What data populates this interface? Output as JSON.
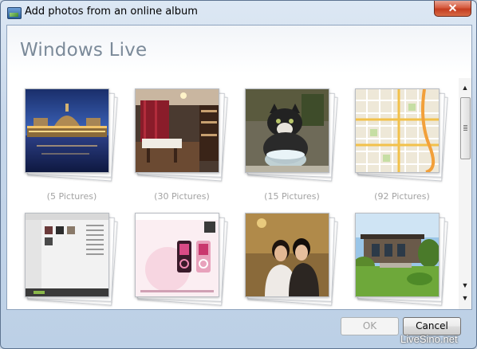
{
  "window": {
    "title": "Add photos from an online album",
    "close_glyph": "✕"
  },
  "header": {
    "brand": "Windows Live"
  },
  "albums": [
    {
      "caption": "(5 Pictures)",
      "thumbnail": "night-palace-photo"
    },
    {
      "caption": "(30 Pictures)",
      "thumbnail": "room-interior-photo"
    },
    {
      "caption": "(15 Pictures)",
      "thumbnail": "cat-photo"
    },
    {
      "caption": "(92 Pictures)",
      "thumbnail": "map-photo"
    },
    {
      "caption": "",
      "thumbnail": "media-player-screenshot"
    },
    {
      "caption": "",
      "thumbnail": "zune-player-screenshot"
    },
    {
      "caption": "",
      "thumbnail": "two-people-photo"
    },
    {
      "caption": "",
      "thumbnail": "garden-building-photo"
    }
  ],
  "scrollbar": {
    "up_glyph": "▲",
    "down_glyph": "▼",
    "bottom_glyph": "▼"
  },
  "buttons": {
    "ok": "OK",
    "cancel": "Cancel"
  },
  "watermark": "LiveSino.net",
  "colors": {
    "window_frame": "#bcd0e6",
    "close_button": "#c43d20",
    "caption_text": "#a3a3a3",
    "brand_text": "#7b8a99"
  }
}
